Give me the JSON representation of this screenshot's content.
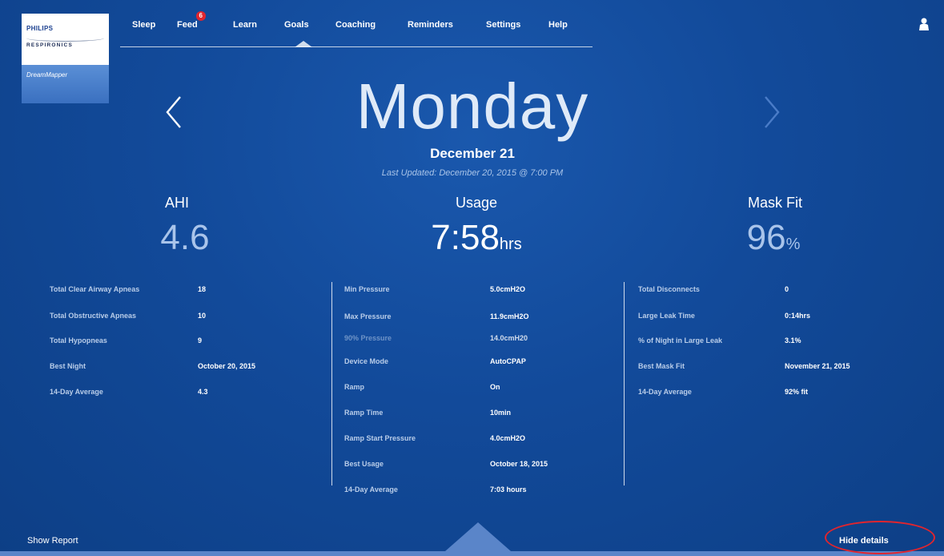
{
  "logo": {
    "brand": "PHILIPS",
    "sub": "RESPIRONICS",
    "app": "DreamMapper"
  },
  "nav": {
    "items": [
      {
        "label": "Sleep"
      },
      {
        "label": "Feed",
        "badge": "6"
      },
      {
        "label": "Learn"
      },
      {
        "label": "Goals"
      },
      {
        "label": "Coaching"
      },
      {
        "label": "Reminders"
      },
      {
        "label": "Settings"
      },
      {
        "label": "Help"
      }
    ],
    "active": "Goals"
  },
  "icons": {
    "user": "user-icon",
    "prev": "chevron-left-icon",
    "next": "chevron-right-icon"
  },
  "day": {
    "title": "Monday",
    "date": "December 21",
    "last_updated": "Last Updated: December 20, 2015 @ 7:00 PM"
  },
  "metrics": {
    "ahi": {
      "label": "AHI",
      "value": "4.6"
    },
    "usage": {
      "label": "Usage",
      "value": "7:58",
      "unit": "hrs"
    },
    "mask_fit": {
      "label": "Mask Fit",
      "value": "96",
      "unit": "%"
    }
  },
  "details": {
    "left": [
      {
        "k": "Total Clear Airway Apneas",
        "v": "18"
      },
      {
        "k": "Total Obstructive Apneas",
        "v": "10"
      },
      {
        "k": "Total Hypopneas",
        "v": "9"
      },
      {
        "k": "Best Night",
        "v": "October 20, 2015"
      },
      {
        "k": "14-Day Average",
        "v": "4.3"
      }
    ],
    "middle": [
      {
        "k": "Min Pressure",
        "v": "5.0cmH2O"
      },
      {
        "k": "Max Pressure",
        "v": "11.9cmH2O"
      },
      {
        "k": "90% Pressure",
        "v": "14.0cmH20"
      },
      {
        "k": "Device Mode",
        "v": "AutoCPAP"
      },
      {
        "k": "Ramp",
        "v": "On"
      },
      {
        "k": "Ramp Time",
        "v": "10min"
      },
      {
        "k": "Ramp Start Pressure",
        "v": "4.0cmH2O"
      },
      {
        "k": "Best Usage",
        "v": "October 18, 2015"
      },
      {
        "k": "14-Day Average",
        "v": "7:03 hours"
      }
    ],
    "right": [
      {
        "k": "Total Disconnects",
        "v": "0"
      },
      {
        "k": "Large Leak Time",
        "v": "0:14hrs"
      },
      {
        "k": "% of Night in Large Leak",
        "v": "3.1%"
      },
      {
        "k": "Best Mask Fit",
        "v": "November 21, 2015"
      },
      {
        "k": "14-Day Average",
        "v": "92% fit"
      }
    ]
  },
  "footer": {
    "show_report": "Show Report",
    "hide_details": "Hide details"
  },
  "colors": {
    "background": "#124a9a",
    "badge": "#e0252e",
    "annotation_ring": "#e0252e"
  }
}
